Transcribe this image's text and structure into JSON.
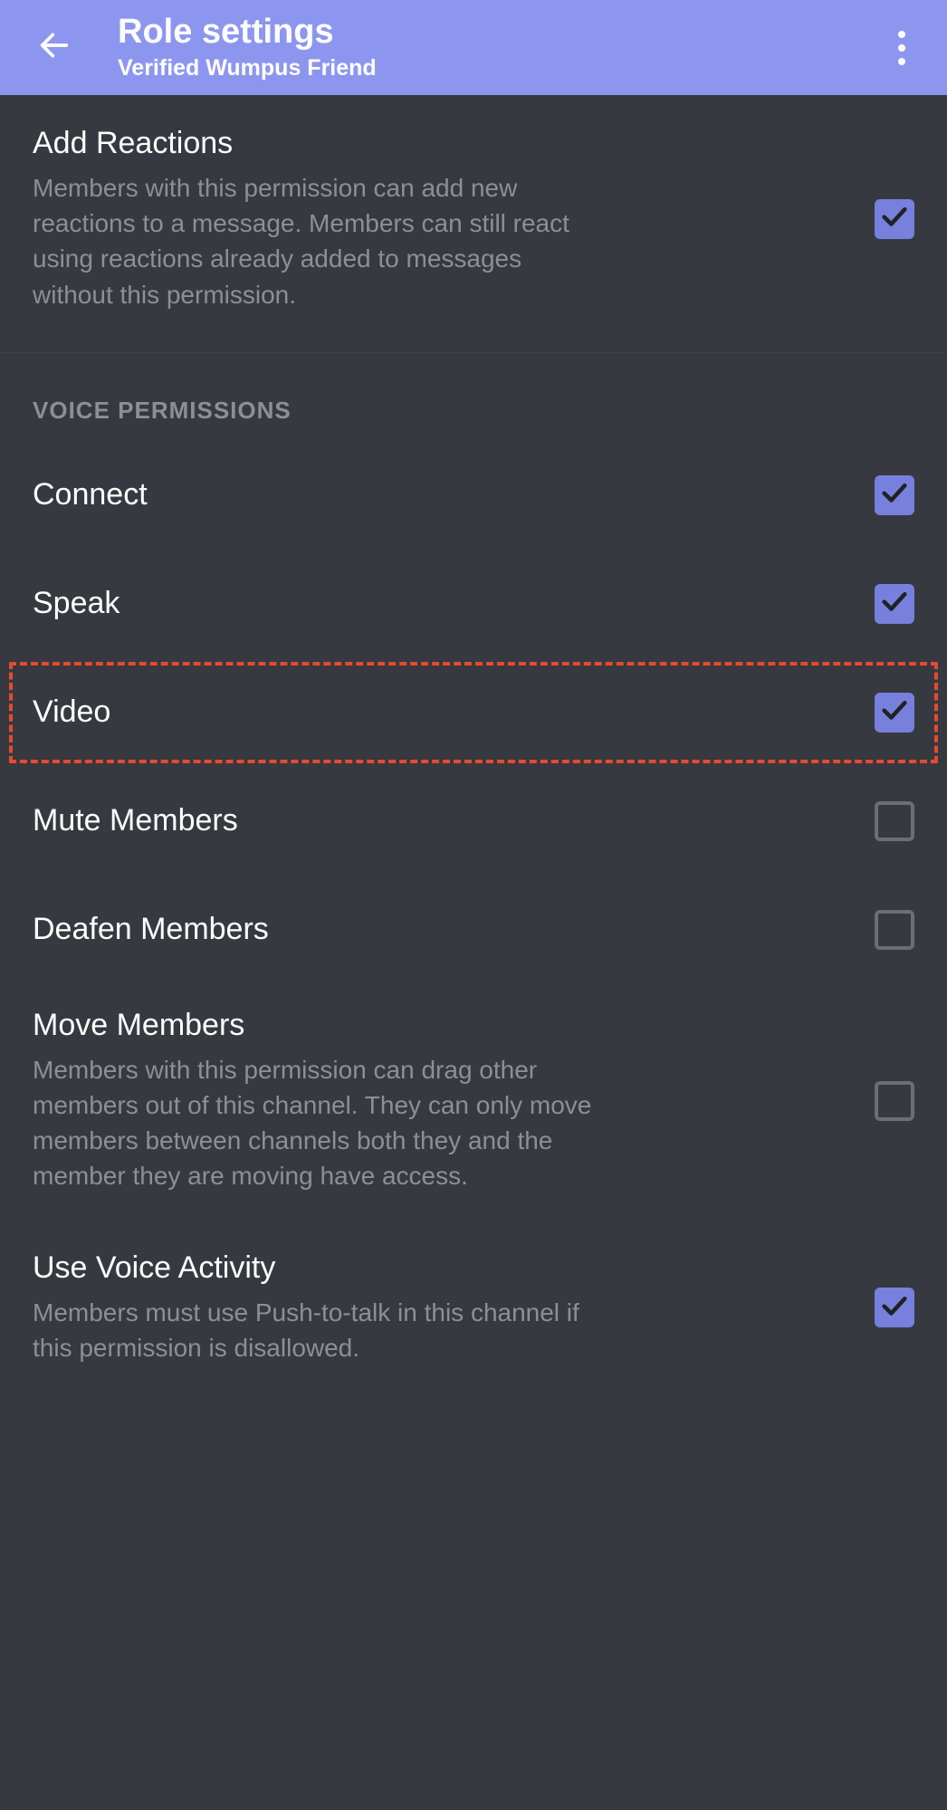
{
  "header": {
    "title": "Role settings",
    "subtitle": "Verified Wumpus Friend"
  },
  "permissions": {
    "addReactions": {
      "title": "Add Reactions",
      "description": "Members with this permission can add new reactions to a message. Members can still react using reactions already added to messages without this permission.",
      "checked": true
    },
    "voiceSectionHeader": "VOICE PERMISSIONS",
    "connect": {
      "title": "Connect",
      "checked": true
    },
    "speak": {
      "title": "Speak",
      "checked": true
    },
    "video": {
      "title": "Video",
      "checked": true,
      "highlighted": true
    },
    "muteMembers": {
      "title": "Mute Members",
      "checked": false
    },
    "deafenMembers": {
      "title": "Deafen Members",
      "checked": false
    },
    "moveMembers": {
      "title": "Move Members",
      "description": "Members with this permission can drag other members out of this channel. They can only move members between channels both they and the member they are moving have access.",
      "checked": false
    },
    "useVoiceActivity": {
      "title": "Use Voice Activity",
      "description": "Members must use Push-to-talk in this channel if this permission is disallowed.",
      "checked": true
    }
  },
  "colors": {
    "headerBg": "#8d96ef",
    "bodyBg": "#36393f",
    "accent": "#7880dd",
    "highlight": "#e74a2f"
  }
}
